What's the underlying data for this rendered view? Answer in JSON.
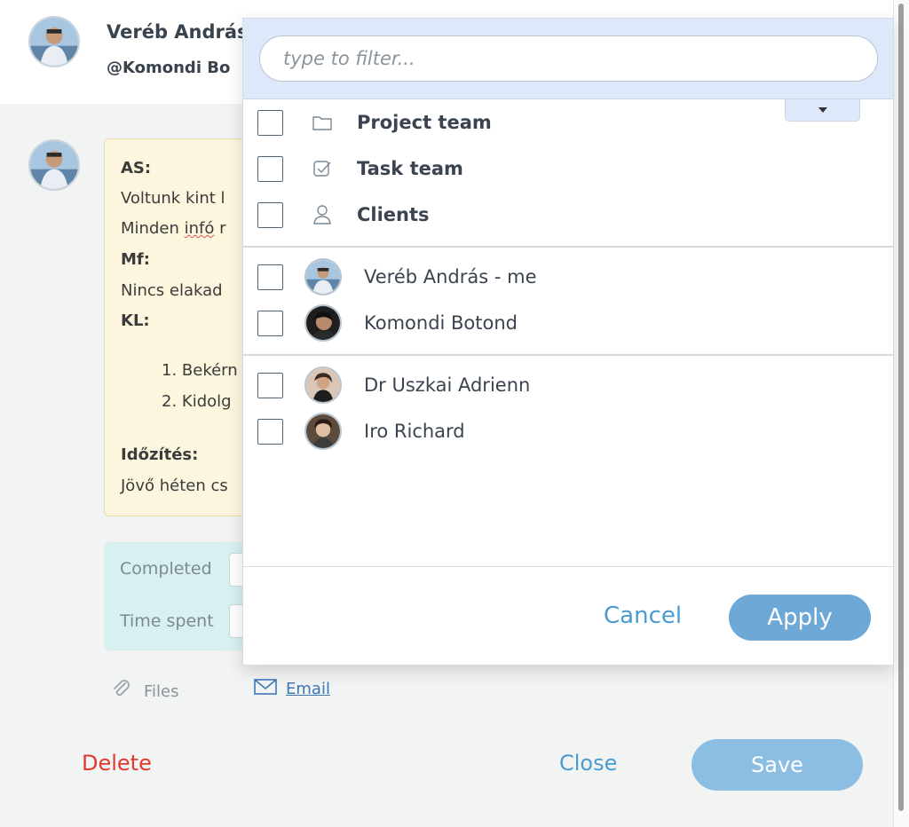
{
  "header": {
    "name": "Veréb András",
    "mention": "@Komondi Bo"
  },
  "note": {
    "as_label": "AS:",
    "line1": "Voltunk kint l",
    "line2_a": "Minden ",
    "line2_b": "infó",
    "line2_c": " r",
    "mf_label": "Mf:",
    "line3": "Nincs elakad",
    "kl_label": "KL:",
    "item1": "1. Bekérn",
    "item2": "2. Kidolg",
    "timing_label": "Időzítés:",
    "line4": "Jövő héten cs"
  },
  "time": {
    "completed_label": "Completed",
    "time_spent_label": "Time spent"
  },
  "attachments": {
    "files_label": "Files",
    "email_label": "Email"
  },
  "actions": {
    "delete_label": "Delete",
    "close_label": "Close",
    "save_label": "Save"
  },
  "dropdown": {
    "filter_placeholder": "type to filter...",
    "groups": [
      {
        "label": "Project team",
        "icon": "folder-icon",
        "checked": false
      },
      {
        "label": "Task team",
        "icon": "check-square-icon",
        "checked": false
      },
      {
        "label": "Clients",
        "icon": "person-icon",
        "checked": false
      }
    ],
    "team_members": [
      {
        "label": "Veréb András - me",
        "checked": false
      },
      {
        "label": "Komondi Botond",
        "checked": false
      }
    ],
    "clients": [
      {
        "label": "Dr Uszkai Adrienn",
        "checked": false
      },
      {
        "label": "Iro Richard",
        "checked": false
      }
    ],
    "cancel_label": "Cancel",
    "apply_label": "Apply"
  },
  "colors": {
    "accent": "#4a9bd1",
    "apply_button": "#6ea8d7",
    "save_button": "#8cbde2",
    "delete": "#e2392f",
    "filter_bar": "#dde9fa",
    "note_background": "#fdf6de",
    "time_background": "#d8f0f0"
  }
}
